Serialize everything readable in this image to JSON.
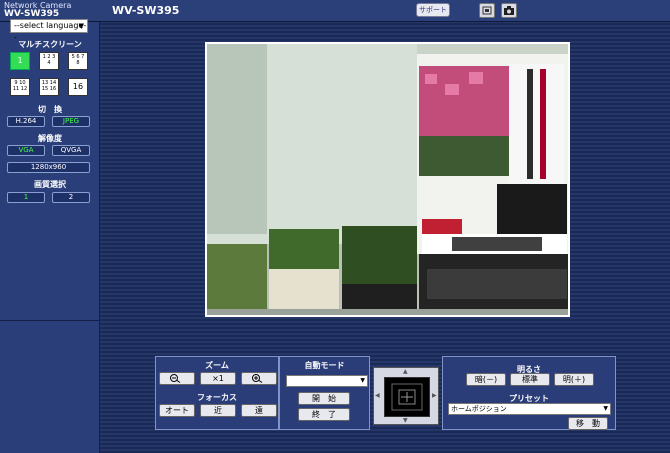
{
  "header": {
    "brand_line1": "Network Camera",
    "brand_line2": "WV-SW395",
    "model_title": "WV-SW395",
    "support_label": "サポート",
    "icons": [
      "fullscreen-icon",
      "snapshot-icon"
    ]
  },
  "sidebar": {
    "language_select": "--select language--",
    "multiscreen_title": "マルチスクリーン",
    "multiscreen_buttons": [
      "1",
      "1 2 3 4",
      "5 6 7 8",
      "9 10 11 12",
      "13 14 15 16",
      "16"
    ],
    "switch_title": "切　換",
    "codec_buttons": [
      "H.264",
      "JPEG"
    ],
    "resolution_title": "解像度",
    "resolution_buttons": [
      "VGA",
      "QVGA",
      "1280x960"
    ],
    "quality_title": "画質選択",
    "quality_buttons": [
      "1",
      "2"
    ]
  },
  "controls": {
    "zoom_title": "ズーム",
    "zoom_x1": "×1",
    "focus_title": "フォーカス",
    "focus_buttons": [
      "オート",
      "近",
      "遠"
    ],
    "auto_mode_title": "自動モード",
    "auto_mode_start": "開　始",
    "auto_mode_end": "終　了",
    "brightness_title": "明るさ",
    "brightness_buttons": [
      "暗(－)",
      "標準",
      "明(＋)"
    ],
    "preset_title": "プリセット",
    "preset_select": "ホームポジション",
    "preset_move": "移　動"
  }
}
